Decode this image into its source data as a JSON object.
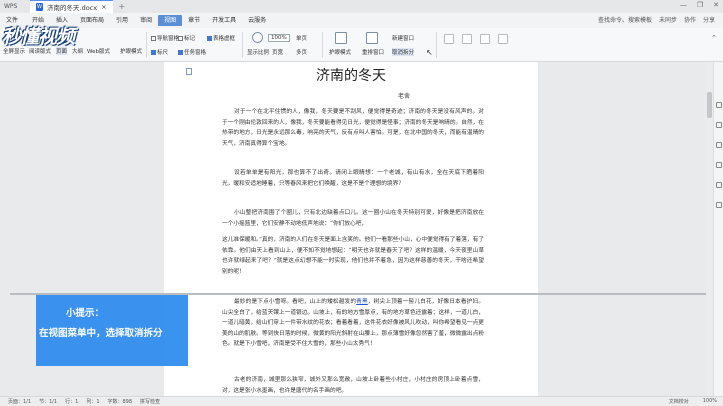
{
  "titlebar": {
    "app_tab": "WPS",
    "doc_tab": "济南的冬天.docx",
    "new_tab": "+",
    "controls": [
      "—",
      "❐",
      "✕"
    ]
  },
  "menubar": {
    "items": [
      "文件",
      "开始",
      "插入",
      "页面布局",
      "引用",
      "审阅",
      "视图",
      "章节",
      "开发工具",
      "云服务"
    ],
    "active": "视图",
    "right": [
      "查找命令、搜索模板",
      "未同步",
      "协作",
      "分享"
    ]
  },
  "ribbon": {
    "full_display": "全屏显示",
    "reading_layout": "阅读版式",
    "page_view": "页面",
    "outline": "大纲",
    "web_layout": "Web版式",
    "eye_mode": "护眼模式",
    "nav_pane": "导航窗格",
    "task_pane": "任务窗格",
    "table_gridlines": "表格虚框",
    "markup_pane": "标记",
    "ruler": "标尺",
    "gridlines": "网格线",
    "display_ratio": "显示比例",
    "zoom_value": "100%",
    "page_width": "页宽",
    "one_page": "单页",
    "multi_page": "多页",
    "new_window": "新建窗口",
    "arrange_all": "重排窗口",
    "split_window": "拆分窗口",
    "cancel_split": "取消拆分",
    "eye_protect": "护眼模式"
  },
  "watermark": "秒懂视频",
  "document": {
    "title": "济南的冬天",
    "author": "老舍",
    "paragraphs": [
      "对于一个在北平住惯的人，像我，冬天要是不刮风，便觉得是奇迹；济南的冬天是没有风声的。对于一个刚由伦敦回来的人，像我，冬天要能看得见日光，便觉得是怪事；济南的冬天是响晴的。自然，在热带的地方，日光是永远那么毒，响亮的天气，反有点叫人害怕。可是，在北中国的冬天，而能有温晴的天气，济南真得算个宝地。",
      "设若单单是有阳光，那也算不了出奇。请闭上眼睛想：一个老城，有山有水，全在天底下晒着阳光，暖和安适地睡着，只等春风来把它们唤醒，这是不是个理想的境界？",
      "小山整把济南围了个圈儿，只有北边缺着点口儿。这一圈小山在冬天特别可爱，好像是把济南放在一个小摇篮里，它们安静不动地低声地说：“你们放心吧，",
      "这儿准保暖和。”真的，济南的人们在冬天是面上含笑的。他们一看那些小山，心中便觉得有了着落，有了依靠。他们由天上看到山上，便不知不觉地想起：“明天也许就是春天了吧？这样的温暖，今天夜里山草也许就绿起来了吧？”就是这点幻想不能一时实现，他们也并不着急，因为这样慈善的冬天，干啥还希望别的呢！",
      "最妙的是下点小雪呀。看吧，山上的矮松越发的青黑，树尖上顶着一髻儿白花，好像日本看护妇。山尖全白了，给蓝天镶上一道银边。山坡上，有的地方雪厚点，有的地方草色还露着；这样，一道儿白，一道儿暗黄，给山们穿上一件带水纹的花衣；看着看着，这件花衣好像被风儿吹动，叫你希望看见一点更美的山的肌肤。等到快日落的时候，微黄的阳光斜射在山腰上，那点薄雪好像忽然害了羞，微微露出点粉色。就是下小雪吧，济南是受不住大雪的，那些小山太秀气！",
      "古老的济南，城里那么狭窄，城外又那么宽敞，山坡上卧着些小村庄，小村庄的房顶上卧着点雪，对，这是张小水墨画，也许是唐代的名手画的吧。"
    ],
    "link_word": "青黑"
  },
  "statusbar": {
    "left": [
      "页面：1/1",
      "节：1/1",
      "行：1",
      "列：1",
      "字数：898",
      "拼写检查"
    ],
    "right": [
      "文档校对",
      "100%"
    ]
  },
  "tip": {
    "title": "小提示：",
    "body": "在视图菜单中，选择取消拆分"
  },
  "colors": {
    "accent": "#5a8fd6",
    "tip_bg": "#2d8bef"
  }
}
